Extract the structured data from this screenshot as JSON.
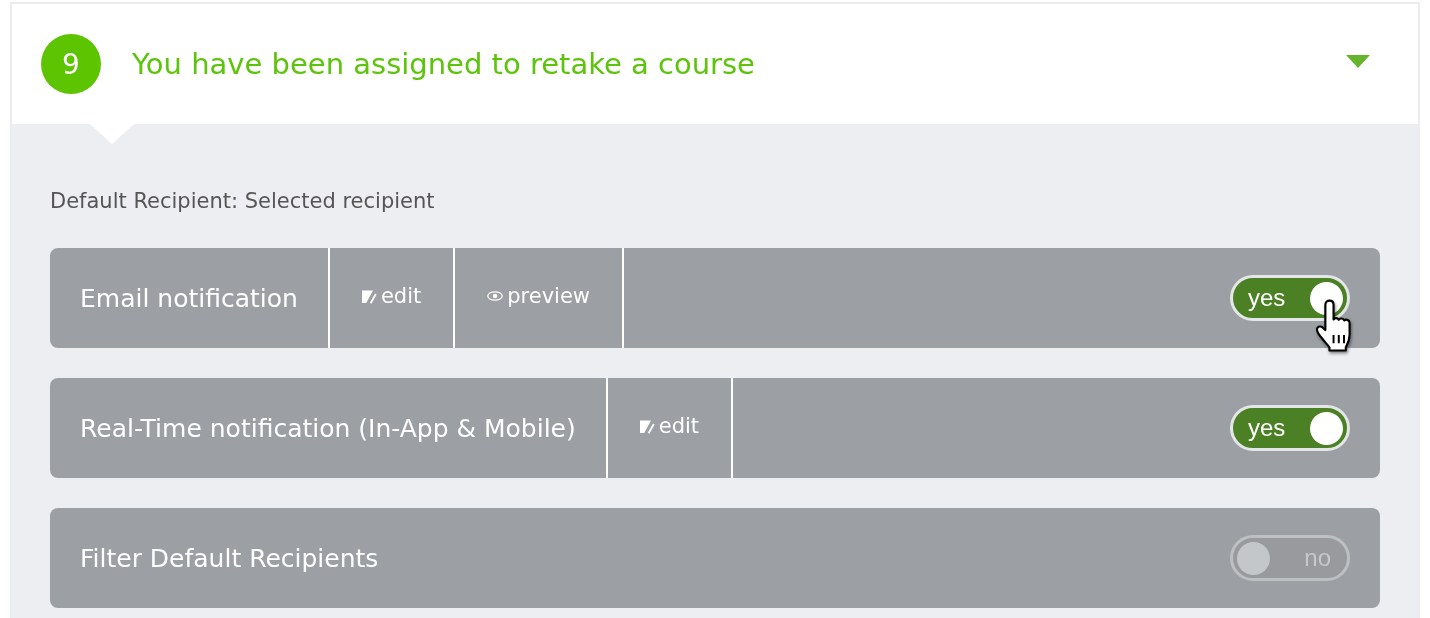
{
  "header": {
    "number": "9",
    "title": "You have been assigned to retake a course",
    "expanded": true
  },
  "default_recipient": "Default Recipient: Selected recipient",
  "settings": [
    {
      "label": "Email notification",
      "actions": [
        {
          "kind": "edit",
          "label": "edit"
        },
        {
          "kind": "preview",
          "label": "preview"
        }
      ],
      "toggle": {
        "on": true,
        "label": "yes"
      }
    },
    {
      "label": "Real-Time notification (In-App & Mobile)",
      "actions": [
        {
          "kind": "edit",
          "label": "edit"
        }
      ],
      "toggle": {
        "on": true,
        "label": "yes"
      }
    },
    {
      "label": "Filter Default Recipients",
      "toggle": {
        "on": false,
        "label": "no"
      }
    }
  ]
}
